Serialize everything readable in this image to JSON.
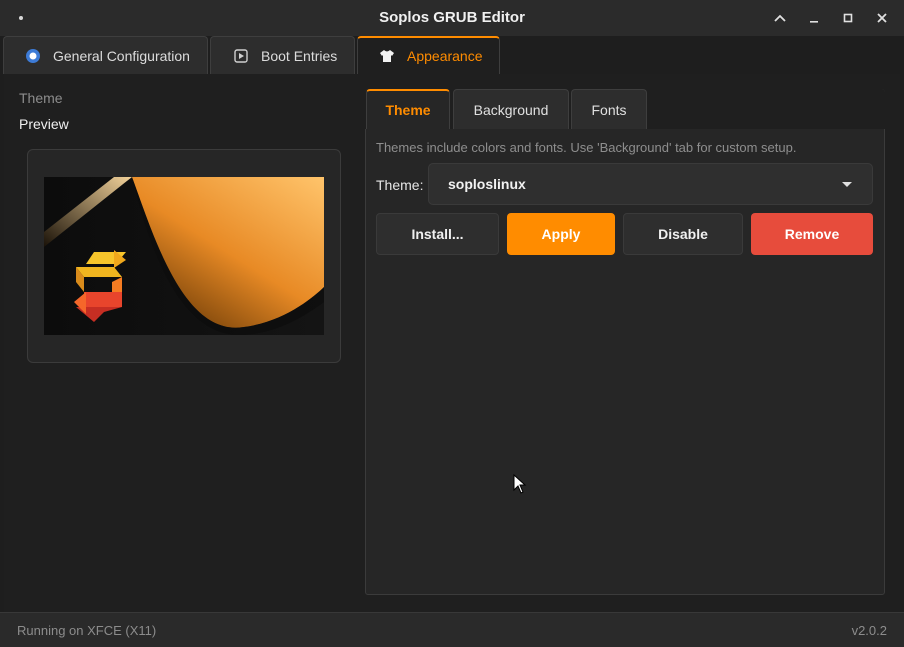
{
  "window": {
    "title": "Soplos GRUB Editor",
    "controls": [
      "chevron-up-icon",
      "minimize-icon",
      "maximize-icon",
      "close-icon"
    ]
  },
  "main_tabs": [
    {
      "label": "General Configuration",
      "icon": "config-icon",
      "active": false
    },
    {
      "label": "Boot Entries",
      "icon": "play-box-icon",
      "active": false
    },
    {
      "label": "Appearance",
      "icon": "shirt-icon",
      "active": true
    }
  ],
  "left": {
    "section_label": "Theme",
    "preview_label": "Preview"
  },
  "sub_tabs": [
    {
      "label": "Theme",
      "active": true
    },
    {
      "label": "Background",
      "active": false
    },
    {
      "label": "Fonts",
      "active": false
    }
  ],
  "theme_panel": {
    "hint": "Themes include colors and fonts. Use 'Background' tab for custom setup.",
    "theme_label": "Theme:",
    "selected_theme": "soploslinux",
    "buttons": {
      "install": "Install...",
      "apply": "Apply",
      "disable": "Disable",
      "remove": "Remove"
    }
  },
  "status": {
    "left": "Running on XFCE (X11)",
    "right": "v2.0.2"
  },
  "colors": {
    "accent": "#ff8c00",
    "danger": "#e74c3c",
    "background": "#1e1e1e"
  }
}
